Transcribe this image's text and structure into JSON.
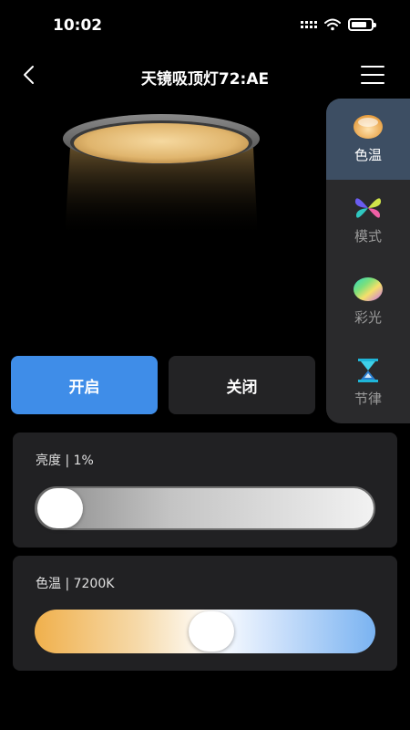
{
  "status_bar": {
    "time": "10:02"
  },
  "header": {
    "title": "天镜吸顶灯72:AE"
  },
  "side_panel": {
    "items": [
      {
        "label": "色温",
        "icon": "color-temperature-icon",
        "active": true
      },
      {
        "label": "模式",
        "icon": "mode-butterfly-icon",
        "active": false
      },
      {
        "label": "彩光",
        "icon": "rainbow-light-icon",
        "active": false
      },
      {
        "label": "节律",
        "icon": "hourglass-rhythm-icon",
        "active": false
      }
    ]
  },
  "buttons": {
    "on_label": "开启",
    "off_label": "关闭"
  },
  "brightness": {
    "label": "亮度 | 1%",
    "value_percent": 1
  },
  "color_temp": {
    "label": "色温 | 7200K",
    "value_fraction": 0.52
  },
  "colors": {
    "accent": "#3f8de8",
    "card": "#212123",
    "panel": "#2a2a2c",
    "panel_active": "#3d4e63"
  }
}
